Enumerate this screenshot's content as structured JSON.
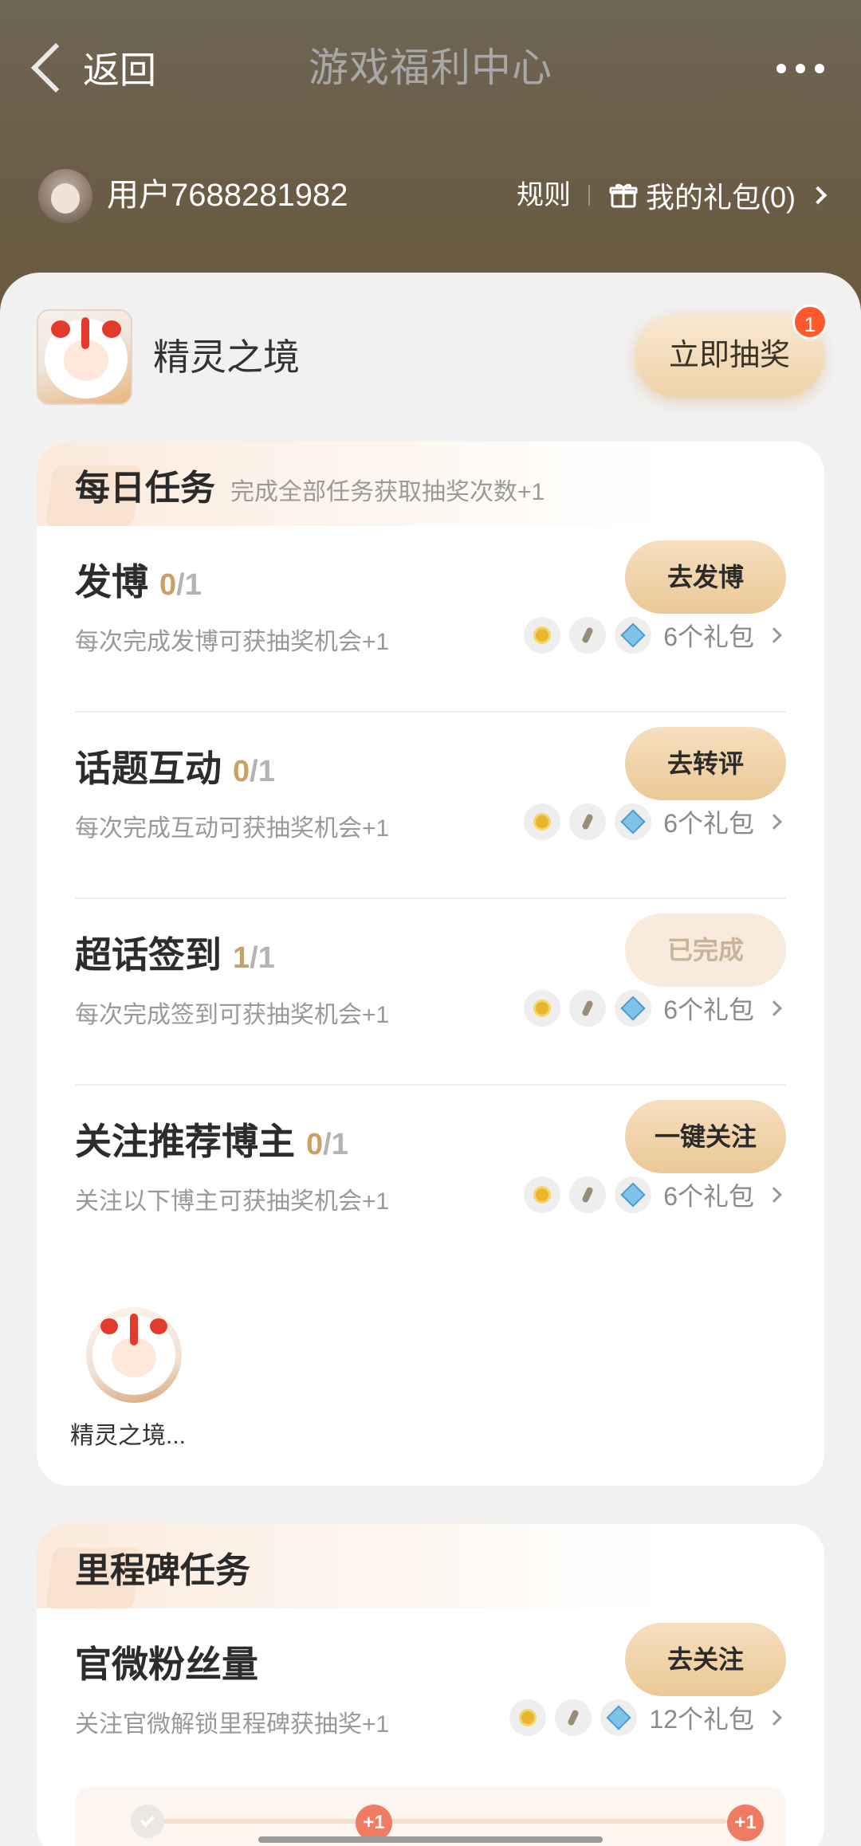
{
  "header": {
    "back_label": "返回",
    "title": "游戏福利中心",
    "username": "用户7688281982",
    "rules_label": "规则",
    "my_gifts_label": "我的礼包(0)"
  },
  "game": {
    "name": "精灵之境",
    "draw_button": "立即抽奖",
    "draw_badge": "1"
  },
  "daily": {
    "title": "每日任务",
    "subtitle": "完成全部任务获取抽奖次数+1",
    "tasks": [
      {
        "name": "发博",
        "current": "0",
        "total": "/1",
        "desc": "每次完成发博可获抽奖机会+1",
        "button": "去发博",
        "rewards": "6个礼包",
        "done": false
      },
      {
        "name": "话题互动",
        "current": "0",
        "total": "/1",
        "desc": "每次完成互动可获抽奖机会+1",
        "button": "去转评",
        "rewards": "6个礼包",
        "done": false
      },
      {
        "name": "超话签到",
        "current": "1",
        "total": "/1",
        "desc": "每次完成签到可获抽奖机会+1",
        "button": "已完成",
        "rewards": "6个礼包",
        "done": true
      },
      {
        "name": "关注推荐博主",
        "current": "0",
        "total": "/1",
        "desc": "关注以下博主可获抽奖机会+1",
        "button": "一键关注",
        "rewards": "6个礼包",
        "done": false
      }
    ],
    "blogger_name": "精灵之境..."
  },
  "milestone": {
    "title": "里程碑任务",
    "task": {
      "name": "官微粉丝量",
      "desc": "关注官微解锁里程碑获抽奖+1",
      "button": "去关注",
      "rewards": "12个礼包"
    },
    "plus_label": "+1"
  },
  "icons": {
    "back": "chevron-left-icon",
    "more": "more-dots-icon",
    "gift": "gift-icon",
    "coin": "coin-icon",
    "feather": "feather-icon",
    "gem": "gem-icon"
  },
  "colors": {
    "header_bg": "#6b5d48",
    "accent_gold": "#ebc896",
    "progress_gold": "#c8a068",
    "badge_red": "#ff5a2e"
  }
}
